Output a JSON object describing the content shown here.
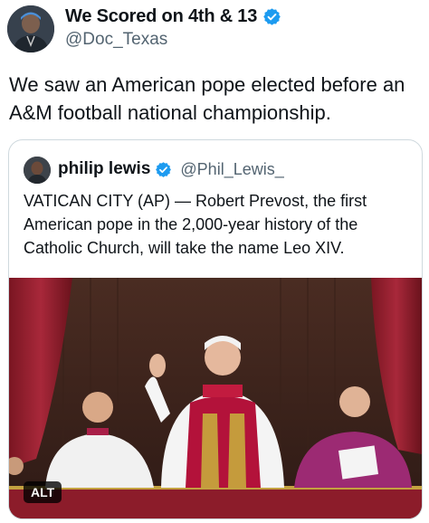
{
  "author": {
    "display_name": "We Scored on 4th & 13",
    "handle": "@Doc_Texas",
    "verified_icon": "verified-badge-icon"
  },
  "tweet": {
    "text": "We saw an American pope elected before an A&M football national championship."
  },
  "quote": {
    "display_name": "philip lewis",
    "handle": "@Phil_Lewis_",
    "text": "VATICAN CITY (AP) — Robert Prevost, the first American pope in the 2,000-year history of the Catholic Church, will take the name Leo XIV.",
    "media": {
      "alt_badge": "ALT"
    }
  },
  "colors": {
    "verified_blue": "#1d9bf0",
    "secondary_text": "#536471",
    "border": "#cfd9de"
  }
}
